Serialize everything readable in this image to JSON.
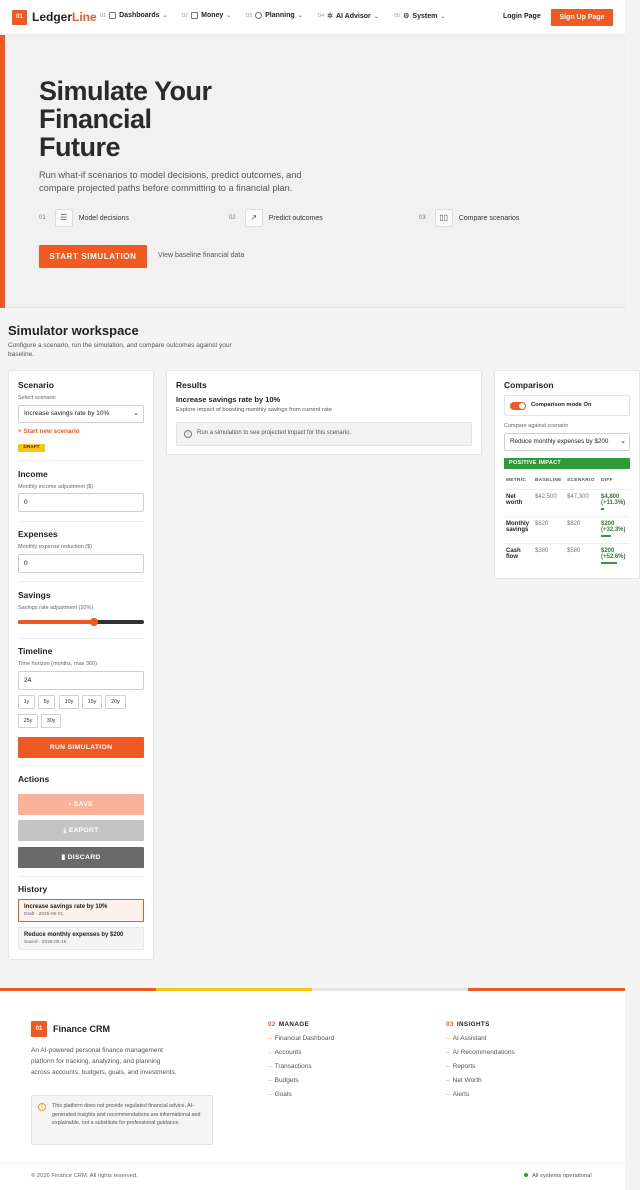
{
  "brand": {
    "badge": "01",
    "name_main": "Ledger",
    "name_accent": "Line"
  },
  "nav": [
    {
      "num": "01",
      "label": "Dashboards",
      "icon": "grid-icon"
    },
    {
      "num": "02",
      "label": "Money",
      "icon": "wallet-icon"
    },
    {
      "num": "03",
      "label": "Planning",
      "icon": "target-icon"
    },
    {
      "num": "04",
      "label": "AI Advisor",
      "icon": "sparkle-icon"
    },
    {
      "num": "05",
      "label": "System",
      "icon": "gear-icon"
    }
  ],
  "auth": {
    "login": "Login Page",
    "signup": "Sign Up Page"
  },
  "hero": {
    "title_l1": "Simulate Your",
    "title_l2": "Financial",
    "title_l3": "Future",
    "subtitle": "Run what-if scenarios to model decisions, predict outcomes, and compare projected paths before committing to a financial plan.",
    "features": [
      {
        "num": "01",
        "label": "Model decisions",
        "icon": "sliders-icon"
      },
      {
        "num": "02",
        "label": "Predict outcomes",
        "icon": "trend-up-icon"
      },
      {
        "num": "03",
        "label": "Compare scenarios",
        "icon": "compare-icon"
      }
    ],
    "cta": "START SIMULATION",
    "secondary": "View baseline financial data"
  },
  "workspace": {
    "title": "Simulator workspace",
    "subtitle": "Configure a scenario, run the simulation, and compare outcomes against your baseline."
  },
  "scenario_panel": {
    "title": "Scenario",
    "select_label": "Select scenario",
    "selected": "Increase savings rate by 10%",
    "new_link": "+  Start new scenario",
    "status_badge": "DRAFT",
    "income_title": "Income",
    "income_label": "Monthly income adjustment ($)",
    "income_value": "0",
    "expenses_title": "Expenses",
    "expenses_label": "Monthly expense reduction ($)",
    "expenses_value": "0",
    "savings_title": "Savings",
    "savings_label": "Savings rate adjustment (10%)",
    "savings_slider_fraction": 0.6,
    "timeline_title": "Timeline",
    "timeline_label": "Time horizon (months, max 360)",
    "timeline_value": "24",
    "presets": [
      "1y",
      "5y",
      "10y",
      "15y",
      "20y",
      "25y",
      "30y"
    ],
    "run": "RUN SIMULATION",
    "actions_title": "Actions",
    "save": "SAVE",
    "export": "EXPORT",
    "discard": "DISCARD",
    "history_title": "History",
    "history": [
      {
        "title": "Increase savings rate by 10%",
        "meta": "Draft · 2026-06-01"
      },
      {
        "title": "Reduce monthly expenses by $200",
        "meta": "Saved · 2026-05-15"
      }
    ]
  },
  "results": {
    "title": "Results",
    "scenario_title": "Increase savings rate by 10%",
    "scenario_desc": "Explore impact of boosting monthly savings from current rate",
    "empty_msg": "Run a simulation to see projected impact for this scenario."
  },
  "comparison": {
    "title": "Comparison",
    "toggle_label": "Comparison mode On",
    "compare_label": "Compare against scenario",
    "compare_selected": "Reduce monthly expenses by $200",
    "impact_badge": "POSITIVE IMPACT",
    "columns": [
      "METRIC",
      "BASELINE",
      "SCENARIO",
      "DIFF"
    ],
    "rows": [
      {
        "metric": "Net worth",
        "baseline": "$42,500",
        "scenario": "$47,300",
        "diff": "$4,800 (+11.3%)",
        "diff_pct": 11.3
      },
      {
        "metric": "Monthly savings",
        "baseline": "$620",
        "scenario": "$820",
        "diff": "$200 (+32.3%)",
        "diff_pct": 32.3
      },
      {
        "metric": "Cash flow",
        "baseline": "$380",
        "scenario": "$580",
        "diff": "$200 (+52.6%)",
        "diff_pct": 52.6
      }
    ]
  },
  "footer": {
    "badge": "01",
    "name": "Finance CRM",
    "desc": "An AI-powered personal finance management platform for tracking, analyzing, and planning across accounts, budgets, goals, and investments.",
    "note": "This platform does not provide regulated financial advice. AI-generated insights and recommendations are informational and explainable, not a substitute for professional guidance.",
    "col1_num": "02",
    "col1_title": "MANAGE",
    "col1_links": [
      "Financial Dashboard",
      "Accounts",
      "Transactions",
      "Budgets",
      "Goals"
    ],
    "col2_num": "03",
    "col2_title": "INSIGHTS",
    "col2_links": [
      "AI Assistant",
      "AI Recommendations",
      "Reports",
      "Net Worth",
      "Alerts"
    ],
    "copyright": "© 2026 Finance CRM. All rights reserved.",
    "status": "All systems operational"
  },
  "colors": {
    "accent": "#f05a22",
    "positive": "#2e9b3a",
    "warning": "#f5c518"
  }
}
